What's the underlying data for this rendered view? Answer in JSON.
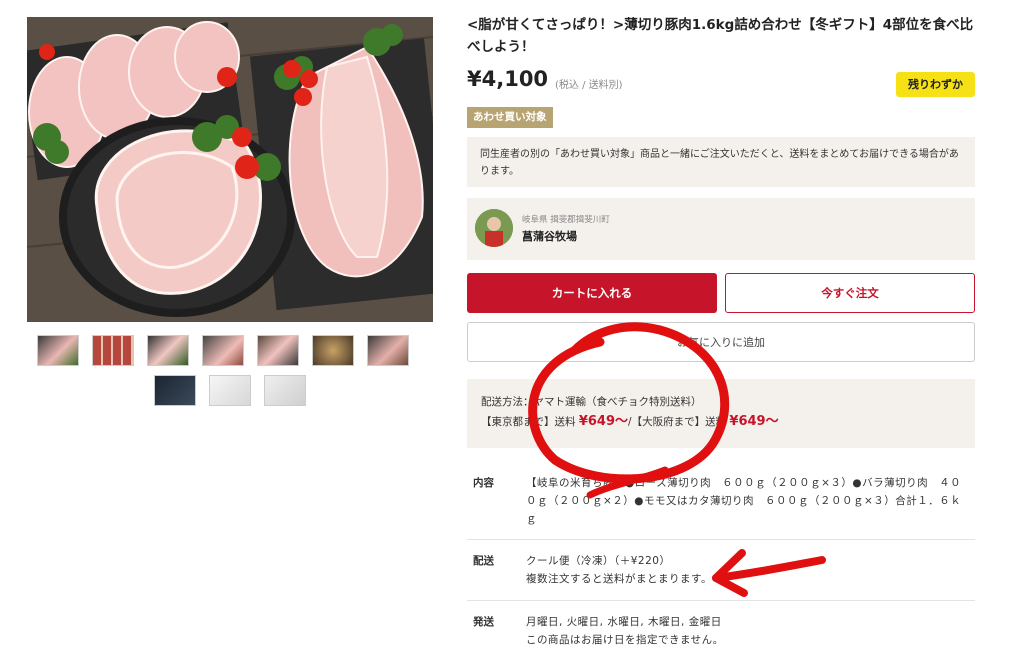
{
  "product": {
    "title": "<脂が甘くてさっぱり！>薄切り豚肉1.6kg詰め合わせ【冬ギフト】4部位を食べ比べしよう！",
    "price": "¥4,100",
    "price_note": "(税込 / 送料別)",
    "stock_badge": "残りわずか",
    "bundle_tag": "あわせ買い対象",
    "bundle_text": "同生産者の別の「あわせ買い対象」商品と一緒にご注文いただくと、送料をまとめてお届けできる場合があります。"
  },
  "farm": {
    "location": "岐阜県 揖斐郡揖斐川町",
    "name": "菖蒲谷牧場"
  },
  "buttons": {
    "cart": "カートに入れる",
    "buy_now": "今すぐ注文",
    "favorite": "お気に入りに追加"
  },
  "shipping": {
    "method": "配送方法：ヤマト運輸（食べチョク特別送料）",
    "tokyo_prefix": "【東京都まで】送料",
    "tokyo_price": "¥649〜",
    "osaka_prefix": "/【大阪府まで】送料",
    "osaka_price": "¥649〜"
  },
  "specs": [
    {
      "label": "内容",
      "value": "【岐阜の米育ち豚】●ロース薄切り肉　６００ｇ（２００ｇ×３）●バラ薄切り肉　４００ｇ（２００ｇ×２）●モモ又はカタ薄切り肉　６００ｇ（２００ｇ×３）合計１．６ｋｇ"
    },
    {
      "label": "配送",
      "value": "クール便（冷凍）（＋¥220）",
      "value2": "複数注文すると送料がまとまります。"
    },
    {
      "label": "発送",
      "value": "月曜日, 火曜日, 水曜日, 木曜日, 金曜日",
      "value2": "この商品はお届け日を指定できません。"
    }
  ],
  "colors": {
    "accent": "#c6142a",
    "badge": "#f6e117",
    "tag": "#b8a373",
    "panel": "#f4f1ec",
    "annotation": "#e01010"
  },
  "annotations": [
    "red-circle",
    "red-arrow"
  ]
}
